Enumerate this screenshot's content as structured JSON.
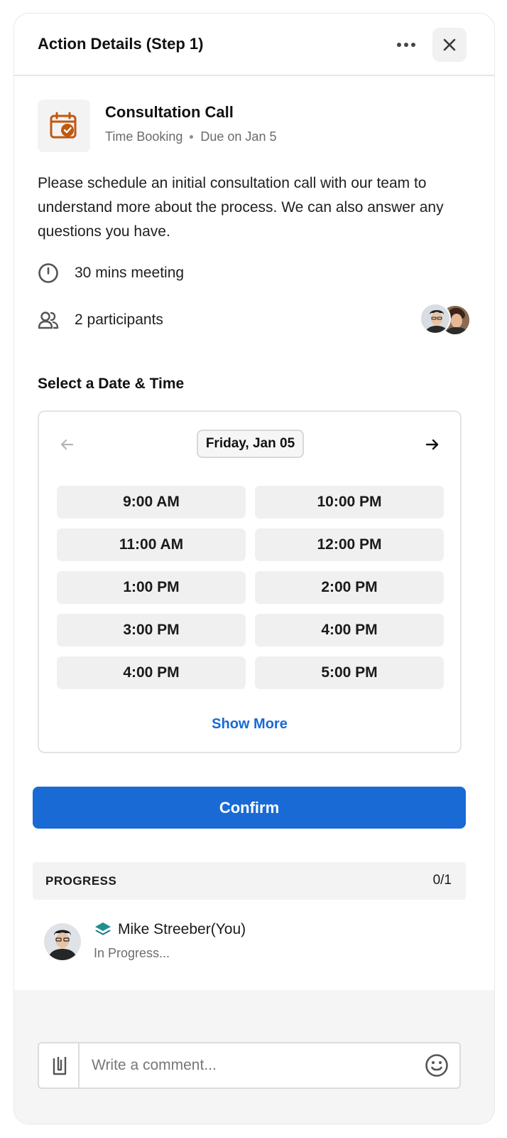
{
  "header": {
    "title": "Action Details (Step 1)",
    "more_icon": "more-horizontal-icon",
    "close_icon": "close-icon"
  },
  "task": {
    "icon": "calendar-check-icon",
    "icon_color": "#c0580f",
    "title": "Consultation Call",
    "type": "Time Booking",
    "due": "Due on Jan 5",
    "description": "Please schedule an initial consultation call with our team to understand more about the process. We can also answer any questions you have.",
    "duration": "30 mins meeting",
    "participants": "2 participants"
  },
  "scheduler": {
    "section_title": "Select a Date & Time",
    "selected_date": "Friday, Jan 05",
    "slots": [
      "9:00 AM",
      "10:00 PM",
      "11:00 AM",
      "12:00 PM",
      "1:00 PM",
      "2:00 PM",
      "3:00 PM",
      "4:00 PM",
      "4:00 PM",
      "5:00 PM"
    ],
    "show_more": "Show More",
    "link_color": "#1769d6"
  },
  "confirm": {
    "label": "Confirm",
    "color": "#1a6ad6"
  },
  "progress": {
    "label": "PROGRESS",
    "count": "0/1",
    "assignee_name": "Mike Streeber(You)",
    "assignee_status": "In Progress..."
  },
  "comment": {
    "placeholder": "Write a comment..."
  }
}
